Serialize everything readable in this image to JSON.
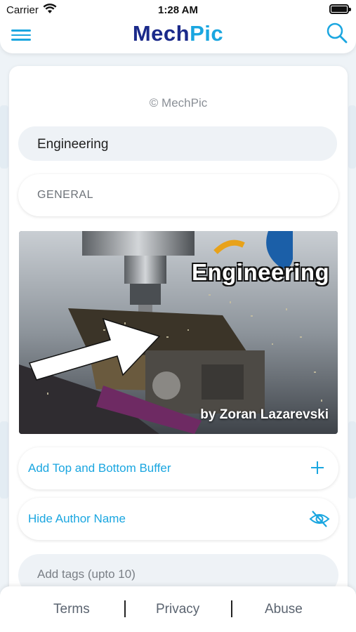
{
  "status_bar": {
    "carrier": "Carrier",
    "time": "1:28 AM"
  },
  "header": {
    "logo_part1": "Mech",
    "logo_part2": "Pic",
    "brand_colors": {
      "primary": "#1b2a8a",
      "accent": "#1aa6e0"
    },
    "icons": [
      "menu-icon",
      "search-icon"
    ]
  },
  "form": {
    "copyright": "© MechPic",
    "category": "Engineering",
    "subcategory": "GENERAL",
    "preview": {
      "title": "Engineering",
      "author": "by Zoran Lazarevski"
    },
    "options": [
      {
        "label": "Add Top and Bottom Buffer",
        "icon": "plus-icon"
      },
      {
        "label": "Hide Author Name",
        "icon": "eye-off-icon"
      }
    ],
    "tags_placeholder": "Add tags (upto 10)"
  },
  "footer": {
    "links": [
      "Terms",
      "Privacy",
      "Abuse"
    ]
  }
}
